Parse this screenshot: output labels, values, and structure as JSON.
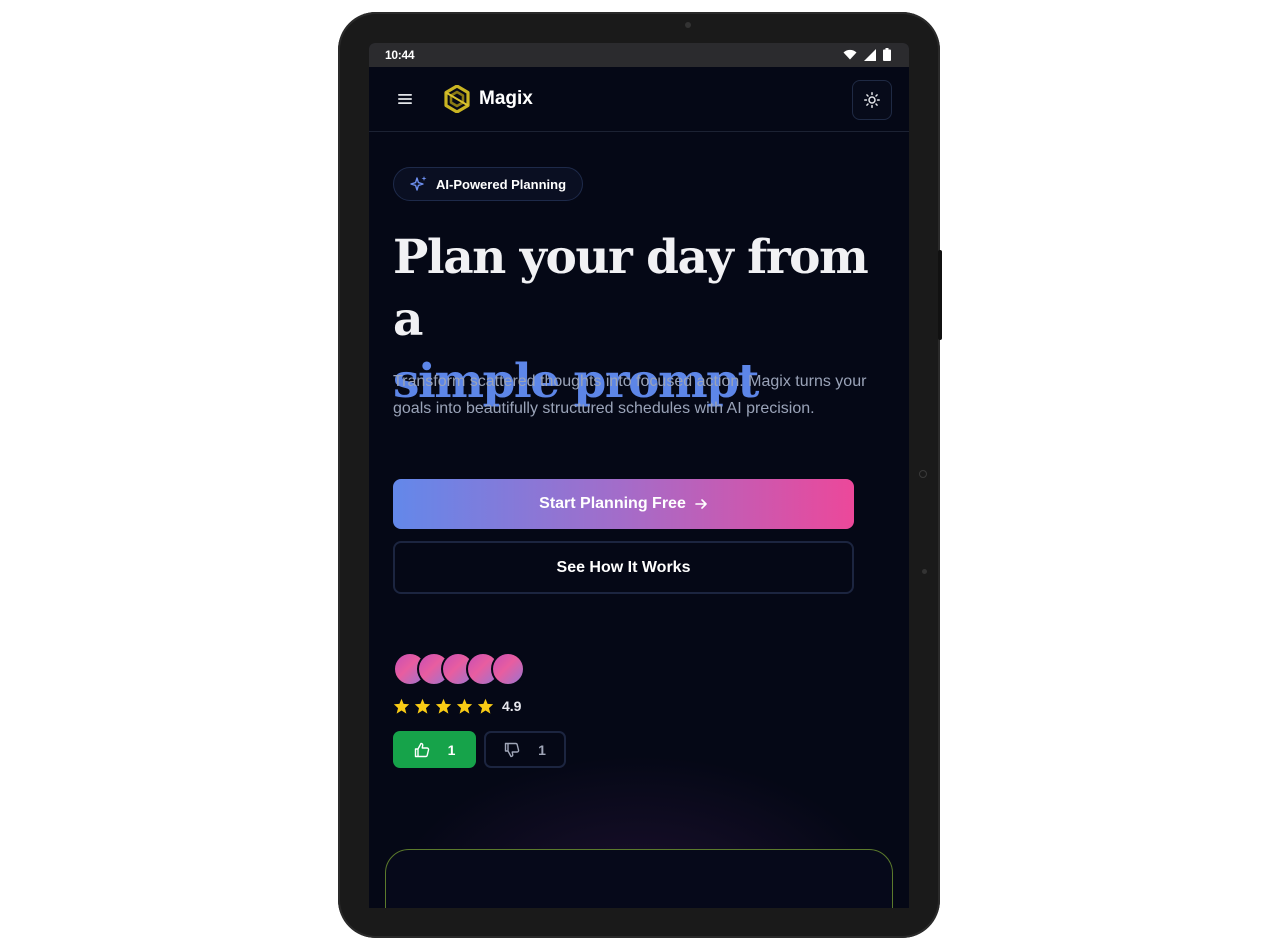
{
  "status_bar": {
    "time": "10:44",
    "icons": [
      "wifi-icon",
      "signal-icon",
      "battery-icon"
    ]
  },
  "navbar": {
    "menu_icon": "hamburger-menu-icon",
    "logo_icon": "magix-logo-icon",
    "brand": "Magix",
    "theme_toggle_icon": "sun-icon"
  },
  "hero": {
    "badge_icon": "sparkles-icon",
    "badge_label": "AI-Powered Planning",
    "title_line1": "Plan your day from a",
    "title_accent": "simple prompt",
    "description": "Transform scattered thoughts into focused action. Magix turns your goals into beautifully structured schedules with AI precision.",
    "primary_cta": "Start Planning Free",
    "primary_cta_icon": "arrow-right-icon",
    "secondary_cta": "See How It Works"
  },
  "social_proof": {
    "avatar_count": 5,
    "stars": 5,
    "rating": "4.9",
    "upvotes": "1",
    "downvotes": "1"
  },
  "colors": {
    "background": "#050816",
    "accent_blue": "#5d86e8",
    "gradient_start": "#6388ea",
    "gradient_end": "#ec489a",
    "upvote_green": "#16a34a",
    "star_yellow": "#facc15",
    "logo_gold": "#c9b422"
  }
}
